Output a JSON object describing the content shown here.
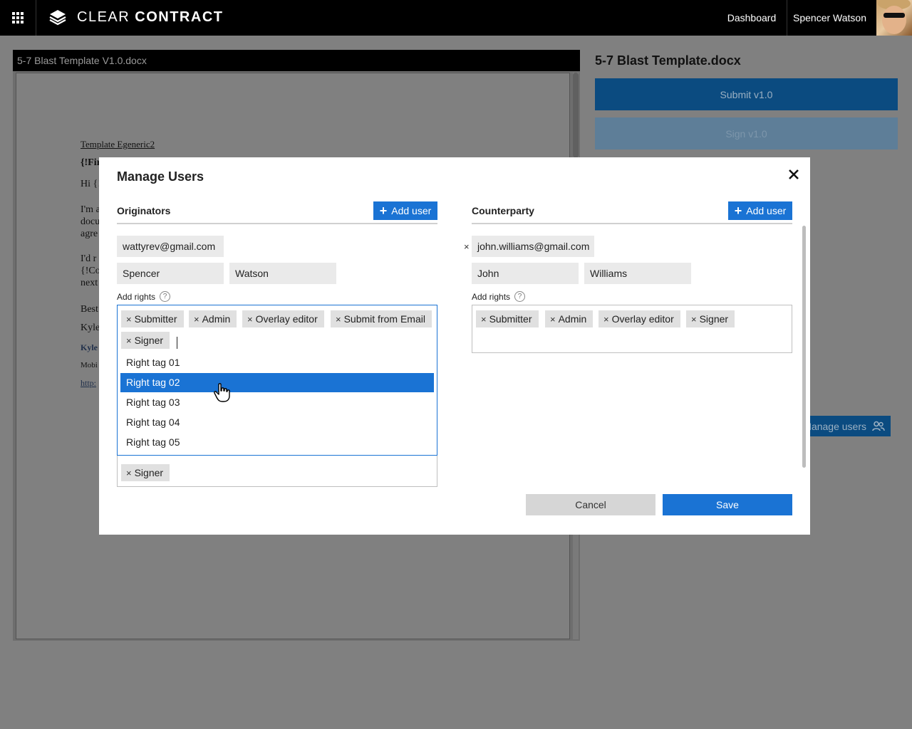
{
  "header": {
    "logo_light": "CLEAR",
    "logo_bold": "CONTRACT",
    "nav_dashboard": "Dashboard",
    "user_name": "Spencer Watson"
  },
  "document": {
    "tab_title": "5-7 Blast Template V1.0.docx",
    "lines": [
      "Template Egeneric2",
      "{!Fir",
      "Hi {!",
      "I'm a",
      "docu",
      "agre",
      "I'd r",
      "{!Co",
      "next",
      "Best",
      "Kyle",
      "Kyle",
      "Mobi",
      "http:"
    ]
  },
  "right_panel": {
    "title": "5-7 Blast Template.docx",
    "submit_label": "Submit v1.0",
    "sign_label": "Sign v1.0",
    "manage_users_label": "Manage users"
  },
  "modal": {
    "title": "Manage Users",
    "add_rights_label": "Add rights",
    "help_glyph": "?",
    "cancel_label": "Cancel",
    "save_label": "Save",
    "originators": {
      "heading": "Originators",
      "add_user_label": "Add user",
      "email": "wattyrev@gmail.com",
      "first_name": "Spencer",
      "last_name": "Watson",
      "rights": [
        "Submitter",
        "Admin",
        "Overlay editor",
        "Submit from Email",
        "Signer"
      ],
      "dropdown_options": [
        "Right tag 01",
        "Right tag 02",
        "Right tag 03",
        "Right tag 04",
        "Right tag 05"
      ],
      "dropdown_selected": "Right tag 02",
      "below_tag": "Signer"
    },
    "counterparty": {
      "heading": "Counterparty",
      "add_user_label": "Add user",
      "email": "john.williams@gmail.com",
      "first_name": "John",
      "last_name": "Williams",
      "rights": [
        "Submitter",
        "Admin",
        "Overlay editor",
        "Signer"
      ]
    }
  },
  "colors": {
    "primary": "#1a73d4",
    "topbar": "#000000",
    "overlay": "#808080"
  },
  "icons": [
    "apps-grid-icon",
    "layers-logo-icon",
    "close-icon",
    "plus-icon",
    "help-icon",
    "remove-x-icon",
    "users-icon",
    "hand-cursor-icon"
  ]
}
